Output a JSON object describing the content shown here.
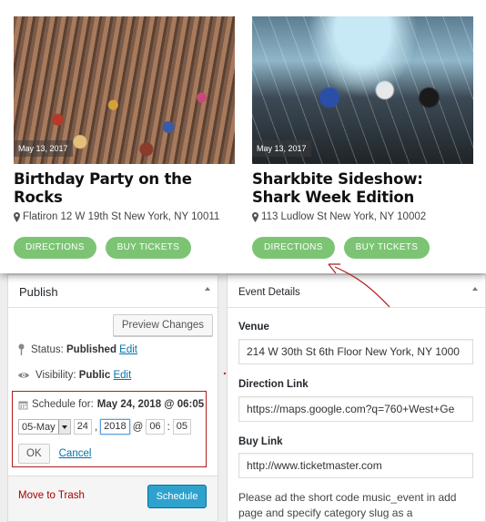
{
  "events": [
    {
      "date": "May 13, 2017",
      "title": "Birthday Party on the Rocks",
      "address": "Flatiron 12 W 19th St New York, NY 10011",
      "directions_label": "DIRECTIONS",
      "tickets_label": "BUY TICKETS"
    },
    {
      "date": "May 13, 2017",
      "title": "Sharkbite Sideshow: Shark Week Edition",
      "address": "113 Ludlow St New York, NY 10002",
      "directions_label": "DIRECTIONS",
      "tickets_label": "BUY TICKETS"
    }
  ],
  "publish": {
    "title": "Publish",
    "preview_label": "Preview Changes",
    "status_label": "Status:",
    "status_value": "Published",
    "status_edit": "Edit",
    "visibility_label": "Visibility:",
    "visibility_value": "Public",
    "visibility_edit": "Edit",
    "schedule_label": "Schedule for:",
    "schedule_value": "May 24, 2018 @ 06:05",
    "month": "05-May",
    "day": "24",
    "year": "2018",
    "at": "@",
    "hour": "06",
    "minute": "05",
    "ok_label": "OK",
    "cancel_label": "Cancel",
    "trash_label": "Move to Trash",
    "schedule_button": "Schedule"
  },
  "details": {
    "title": "Event Details",
    "venue_label": "Venue",
    "venue_value": "214 W 30th St 6th Floor New York, NY 1000",
    "direction_label": "Direction Link",
    "direction_value": "https://maps.google.com?q=760+West+Ge",
    "buy_label": "Buy Link",
    "buy_value": "http://www.ticketmaster.com",
    "help": "Please ad the short code music_event in add page and specify category slug as a"
  },
  "colors": {
    "pill_green": "#7cc474",
    "wp_blue": "#2ea2cc",
    "link_blue": "#0073aa",
    "trash_red": "#aa0000",
    "highlight_red": "#b11c1c"
  }
}
